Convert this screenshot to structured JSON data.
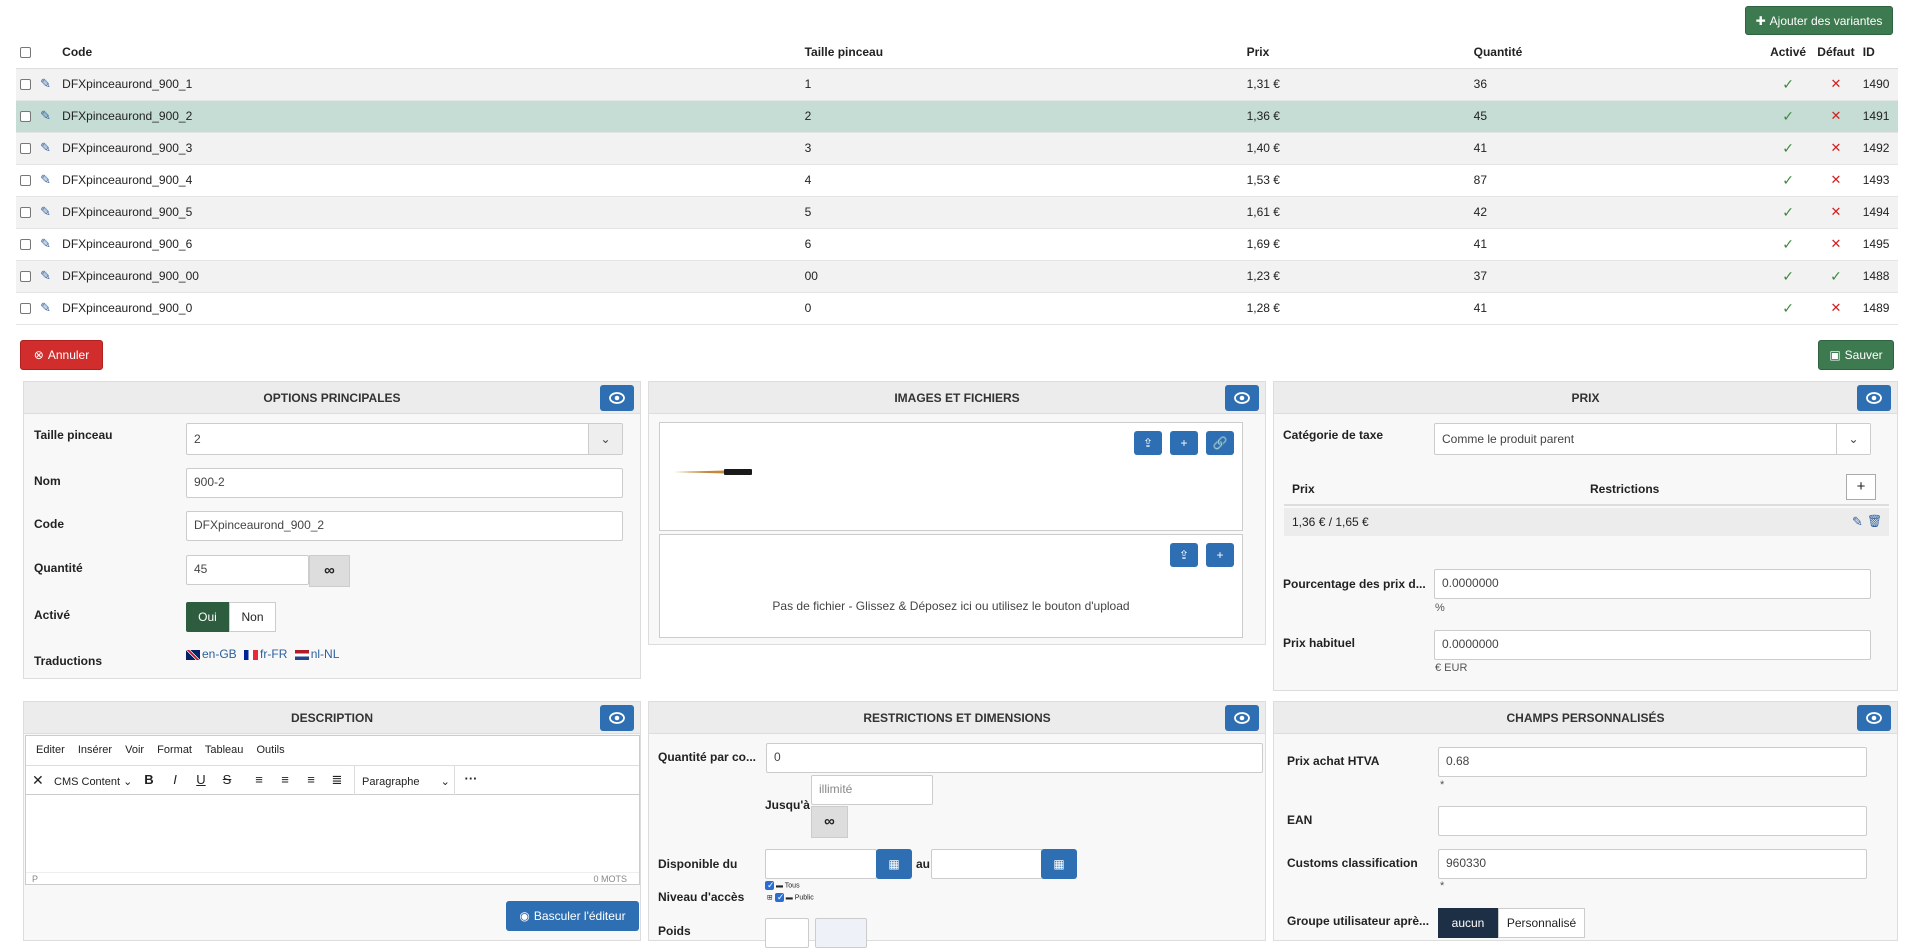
{
  "toolbar": {
    "add_variants_label": "Ajouter des variantes",
    "cancel_label": "Annuler",
    "save_label": "Sauver"
  },
  "table": {
    "headers": {
      "code": "Code",
      "brush_size": "Taille pinceau",
      "price": "Prix",
      "quantity": "Quantité",
      "active": "Activé",
      "default": "Défaut",
      "id": "ID"
    },
    "rows": [
      {
        "code": "DFXpinceaurond_900_1",
        "size": "1",
        "price": "1,31 €",
        "qty": "36",
        "active": true,
        "default": false,
        "id": "1490"
      },
      {
        "code": "DFXpinceaurond_900_2",
        "size": "2",
        "price": "1,36 €",
        "qty": "45",
        "active": true,
        "default": false,
        "id": "1491"
      },
      {
        "code": "DFXpinceaurond_900_3",
        "size": "3",
        "price": "1,40 €",
        "qty": "41",
        "active": true,
        "default": false,
        "id": "1492"
      },
      {
        "code": "DFXpinceaurond_900_4",
        "size": "4",
        "price": "1,53 €",
        "qty": "87",
        "active": true,
        "default": false,
        "id": "1493"
      },
      {
        "code": "DFXpinceaurond_900_5",
        "size": "5",
        "price": "1,61 €",
        "qty": "42",
        "active": true,
        "default": false,
        "id": "1494"
      },
      {
        "code": "DFXpinceaurond_900_6",
        "size": "6",
        "price": "1,69 €",
        "qty": "41",
        "active": true,
        "default": false,
        "id": "1495"
      },
      {
        "code": "DFXpinceaurond_900_00",
        "size": "00",
        "price": "1,23 €",
        "qty": "37",
        "active": true,
        "default": true,
        "id": "1488"
      },
      {
        "code": "DFXpinceaurond_900_0",
        "size": "0",
        "price": "1,28 €",
        "qty": "41",
        "active": true,
        "default": false,
        "id": "1489"
      }
    ]
  },
  "options": {
    "title": "OPTIONS PRINCIPALES",
    "brush_size_label": "Taille pinceau",
    "brush_size_value": "2",
    "name_label": "Nom",
    "name_value": "900-2",
    "code_label": "Code",
    "code_value": "DFXpinceaurond_900_2",
    "qty_label": "Quantité",
    "qty_value": "45",
    "active_label": "Activé",
    "yes": "Oui",
    "no": "Non",
    "translations_label": "Traductions",
    "translations": [
      "en-GB",
      "fr-FR",
      "nl-NL"
    ]
  },
  "images": {
    "title": "IMAGES ET FICHIERS",
    "no_file_text": "Pas de fichier - Glissez & Déposez ici ou utilisez le bouton d'upload"
  },
  "price": {
    "title": "PRIX",
    "tax_label": "Catégorie de taxe",
    "tax_value": "Comme le produit parent",
    "col_price": "Prix",
    "col_restrictions": "Restrictions",
    "row_price": "1,36 € / 1,65 €",
    "percent_label": "Pourcentage des prix d...",
    "percent_value": "0.0000000",
    "percent_unit": "%",
    "usual_label": "Prix habituel",
    "usual_value": "0.0000000",
    "usual_unit": "€ EUR"
  },
  "description": {
    "title": "DESCRIPTION",
    "menu": [
      "Editer",
      "Insérer",
      "Voir",
      "Format",
      "Tableau",
      "Outils"
    ],
    "cms_label": "CMS Content",
    "paragraph_label": "Paragraphe",
    "status_path": "P",
    "word_count": "0 MOTS",
    "toggle_editor": "Basculer l'éditeur"
  },
  "restrictions": {
    "title": "RESTRICTIONS ET DIMENSIONS",
    "qty_per_label": "Quantité par co...",
    "qty_per_value": "0",
    "until_label": "Jusqu'à",
    "until_placeholder": "illimité",
    "available_label": "Disponible du",
    "to_label": "au",
    "access_label": "Niveau d'accès",
    "access_all": "Tous",
    "access_public": "Public",
    "partial_label": "Poids"
  },
  "custom": {
    "title": "CHAMPS PERSONNALISÉS",
    "purchase_label": "Prix achat HTVA",
    "purchase_value": "0.68",
    "ean_label": "EAN",
    "ean_value": "",
    "customs_label": "Customs classification",
    "customs_value": "960330",
    "group_label": "Groupe utilisateur aprè...",
    "group_none": "aucun",
    "group_custom": "Personnalisé",
    "asterisk": "*"
  }
}
